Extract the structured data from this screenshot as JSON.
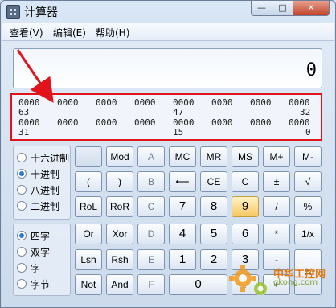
{
  "window": {
    "title": "计算器",
    "controls": {
      "minimize": "—",
      "maximize": "□",
      "close": "✕"
    }
  },
  "menu": [
    {
      "label": "查看(V)"
    },
    {
      "label": "编辑(E)"
    },
    {
      "label": "帮助(H)"
    }
  ],
  "display": {
    "value": "0"
  },
  "bits": {
    "row1_groups": [
      "0000",
      "0000",
      "0000",
      "0000",
      "0000",
      "0000",
      "0000",
      "0000"
    ],
    "row1_positions": [
      "63",
      "47",
      "32"
    ],
    "row2_groups": [
      "0000",
      "0000",
      "0000",
      "0000",
      "0000",
      "0000",
      "0000",
      "0000"
    ],
    "row2_positions": [
      "31",
      "15",
      "0"
    ]
  },
  "number_system": {
    "options": [
      "十六进制",
      "十进制",
      "八进制",
      "二进制"
    ],
    "selected": "十进制"
  },
  "word_size": {
    "options": [
      "四字",
      "双字",
      "字",
      "字节"
    ],
    "selected": "四字"
  },
  "buttons": {
    "row1": [
      "",
      "Mod",
      "A",
      "MC",
      "MR",
      "MS",
      "M+",
      "M-"
    ],
    "row2": [
      "(",
      ")",
      "B",
      "⟵",
      "CE",
      "C",
      "±",
      "√"
    ],
    "row3": [
      "RoL",
      "RoR",
      "C",
      "7",
      "8",
      "9",
      "/",
      "%"
    ],
    "row4": [
      "Or",
      "Xor",
      "D",
      "4",
      "5",
      "6",
      "*",
      "1/x"
    ],
    "row5": [
      "Lsh",
      "Rsh",
      "E",
      "1",
      "2",
      "3",
      "-",
      "="
    ],
    "row6": [
      "Not",
      "And",
      "F",
      "0",
      ".",
      "+"
    ]
  },
  "watermark": {
    "line1": "中华工控网",
    "line2": "gkong.com"
  },
  "annotation_color": "#e1141c"
}
